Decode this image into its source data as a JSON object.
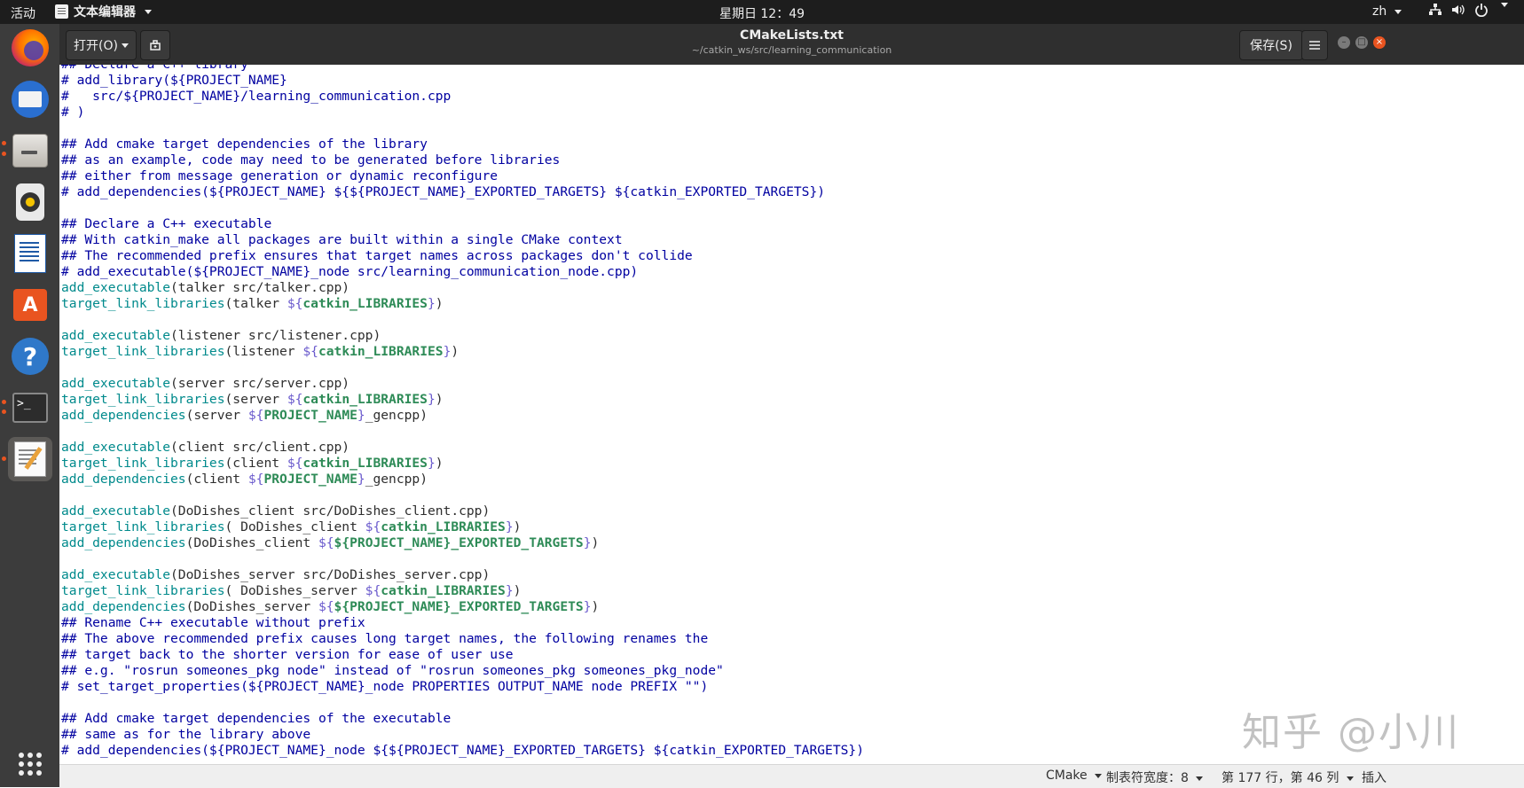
{
  "topbar": {
    "activities": "活动",
    "app_name": "文本编辑器",
    "clock": "星期日 12：49",
    "lang": "zh"
  },
  "header": {
    "open_label": "打开(O)",
    "title": "CMakeLists.txt",
    "subtitle": "~/catkin_ws/src/learning_communication",
    "save_label": "保存(S)"
  },
  "dock": {
    "items": [
      "firefox-icon",
      "thunderbird-icon",
      "files-icon",
      "rhythmbox-icon",
      "libreoffice-writer-icon",
      "software-center-icon",
      "help-icon",
      "terminal-icon",
      "text-editor-icon",
      "show-apps-icon"
    ]
  },
  "code_lines": [
    [
      [
        "c",
        "## Declare a C++ library"
      ]
    ],
    [
      [
        "c",
        "# add_library(${PROJECT_NAME}"
      ]
    ],
    [
      [
        "c",
        "#   src/${PROJECT_NAME}/learning_communication.cpp"
      ]
    ],
    [
      [
        "c",
        "# )"
      ]
    ],
    [],
    [
      [
        "c",
        "## Add cmake target dependencies of the library"
      ]
    ],
    [
      [
        "c",
        "## as an example, code may need to be generated before libraries"
      ]
    ],
    [
      [
        "c",
        "## either from message generation or dynamic reconfigure"
      ]
    ],
    [
      [
        "c",
        "# add_dependencies(${PROJECT_NAME} ${${PROJECT_NAME}_EXPORTED_TARGETS} ${catkin_EXPORTED_TARGETS})"
      ]
    ],
    [],
    [
      [
        "c",
        "## Declare a C++ executable"
      ]
    ],
    [
      [
        "c",
        "## With catkin_make all packages are built within a single CMake context"
      ]
    ],
    [
      [
        "c",
        "## The recommended prefix ensures that target names across packages don't collide"
      ]
    ],
    [
      [
        "c",
        "# add_executable(${PROJECT_NAME}_node src/learning_communication_node.cpp)"
      ]
    ],
    [
      [
        "f",
        "add_executable"
      ],
      [
        "n",
        "(talker src/talker.cpp)"
      ]
    ],
    [
      [
        "f",
        "target_link_libraries"
      ],
      [
        "n",
        "(talker "
      ],
      [
        "v",
        "${"
      ],
      [
        "k",
        "catkin_LIBRARIES"
      ],
      [
        "v",
        "}"
      ],
      [
        "n",
        ")"
      ]
    ],
    [],
    [
      [
        "f",
        "add_executable"
      ],
      [
        "n",
        "(listener src/listener.cpp)"
      ]
    ],
    [
      [
        "f",
        "target_link_libraries"
      ],
      [
        "n",
        "(listener "
      ],
      [
        "v",
        "${"
      ],
      [
        "k",
        "catkin_LIBRARIES"
      ],
      [
        "v",
        "}"
      ],
      [
        "n",
        ")"
      ]
    ],
    [],
    [
      [
        "f",
        "add_executable"
      ],
      [
        "n",
        "(server src/server.cpp)"
      ]
    ],
    [
      [
        "f",
        "target_link_libraries"
      ],
      [
        "n",
        "(server "
      ],
      [
        "v",
        "${"
      ],
      [
        "k",
        "catkin_LIBRARIES"
      ],
      [
        "v",
        "}"
      ],
      [
        "n",
        ")"
      ]
    ],
    [
      [
        "f",
        "add_dependencies"
      ],
      [
        "n",
        "(server "
      ],
      [
        "v",
        "${"
      ],
      [
        "k",
        "PROJECT_NAME"
      ],
      [
        "v",
        "}"
      ],
      [
        "n",
        "_gencpp)"
      ]
    ],
    [],
    [
      [
        "f",
        "add_executable"
      ],
      [
        "n",
        "(client src/client.cpp)"
      ]
    ],
    [
      [
        "f",
        "target_link_libraries"
      ],
      [
        "n",
        "(client "
      ],
      [
        "v",
        "${"
      ],
      [
        "k",
        "catkin_LIBRARIES"
      ],
      [
        "v",
        "}"
      ],
      [
        "n",
        ")"
      ]
    ],
    [
      [
        "f",
        "add_dependencies"
      ],
      [
        "n",
        "(client "
      ],
      [
        "v",
        "${"
      ],
      [
        "k",
        "PROJECT_NAME"
      ],
      [
        "v",
        "}"
      ],
      [
        "n",
        "_gencpp)"
      ]
    ],
    [],
    [
      [
        "f",
        "add_executable"
      ],
      [
        "n",
        "(DoDishes_client src/DoDishes_client.cpp)"
      ]
    ],
    [
      [
        "f",
        "target_link_libraries"
      ],
      [
        "n",
        "( DoDishes_client "
      ],
      [
        "v",
        "${"
      ],
      [
        "k",
        "catkin_LIBRARIES"
      ],
      [
        "v",
        "}"
      ],
      [
        "n",
        ")"
      ]
    ],
    [
      [
        "f",
        "add_dependencies"
      ],
      [
        "n",
        "(DoDishes_client "
      ],
      [
        "v",
        "${"
      ],
      [
        "k",
        "${PROJECT_NAME}_EXPORTED_TARGETS"
      ],
      [
        "v",
        "}"
      ],
      [
        "n",
        ")"
      ]
    ],
    [],
    [
      [
        "f",
        "add_executable"
      ],
      [
        "n",
        "(DoDishes_server src/DoDishes_server.cpp)"
      ]
    ],
    [
      [
        "f",
        "target_link_libraries"
      ],
      [
        "n",
        "( DoDishes_server "
      ],
      [
        "v",
        "${"
      ],
      [
        "k",
        "catkin_LIBRARIES"
      ],
      [
        "v",
        "}"
      ],
      [
        "n",
        ")"
      ]
    ],
    [
      [
        "f",
        "add_dependencies"
      ],
      [
        "n",
        "(DoDishes_server "
      ],
      [
        "v",
        "${"
      ],
      [
        "k",
        "${PROJECT_NAME}_EXPORTED_TARGETS"
      ],
      [
        "v",
        "}"
      ],
      [
        "n",
        ")"
      ]
    ],
    [
      [
        "c",
        "## Rename C++ executable without prefix"
      ]
    ],
    [
      [
        "c",
        "## The above recommended prefix causes long target names, the following renames the"
      ]
    ],
    [
      [
        "c",
        "## target back to the shorter version for ease of user use"
      ]
    ],
    [
      [
        "c",
        "## e.g. \"rosrun someones_pkg node\" instead of \"rosrun someones_pkg someones_pkg_node\""
      ]
    ],
    [
      [
        "c",
        "# set_target_properties(${PROJECT_NAME}_node PROPERTIES OUTPUT_NAME node PREFIX \"\")"
      ]
    ],
    [],
    [
      [
        "c",
        "## Add cmake target dependencies of the executable"
      ]
    ],
    [
      [
        "c",
        "## same as for the library above"
      ]
    ],
    [
      [
        "c",
        "# add_dependencies(${PROJECT_NAME}_node ${${PROJECT_NAME}_EXPORTED_TARGETS} ${catkin_EXPORTED_TARGETS})"
      ]
    ]
  ],
  "watermark": "知乎 @小川",
  "status": {
    "language": "CMake",
    "tab_width": "制表符宽度：8",
    "position": "第 177 行，第 46 列",
    "mode": "插入"
  },
  "colors": {
    "comment": "#0000a0",
    "function": "#008a8c",
    "variable_brace": "#6a5acd",
    "keyword": "#2e8b57",
    "accent_dot": "#e95420"
  }
}
